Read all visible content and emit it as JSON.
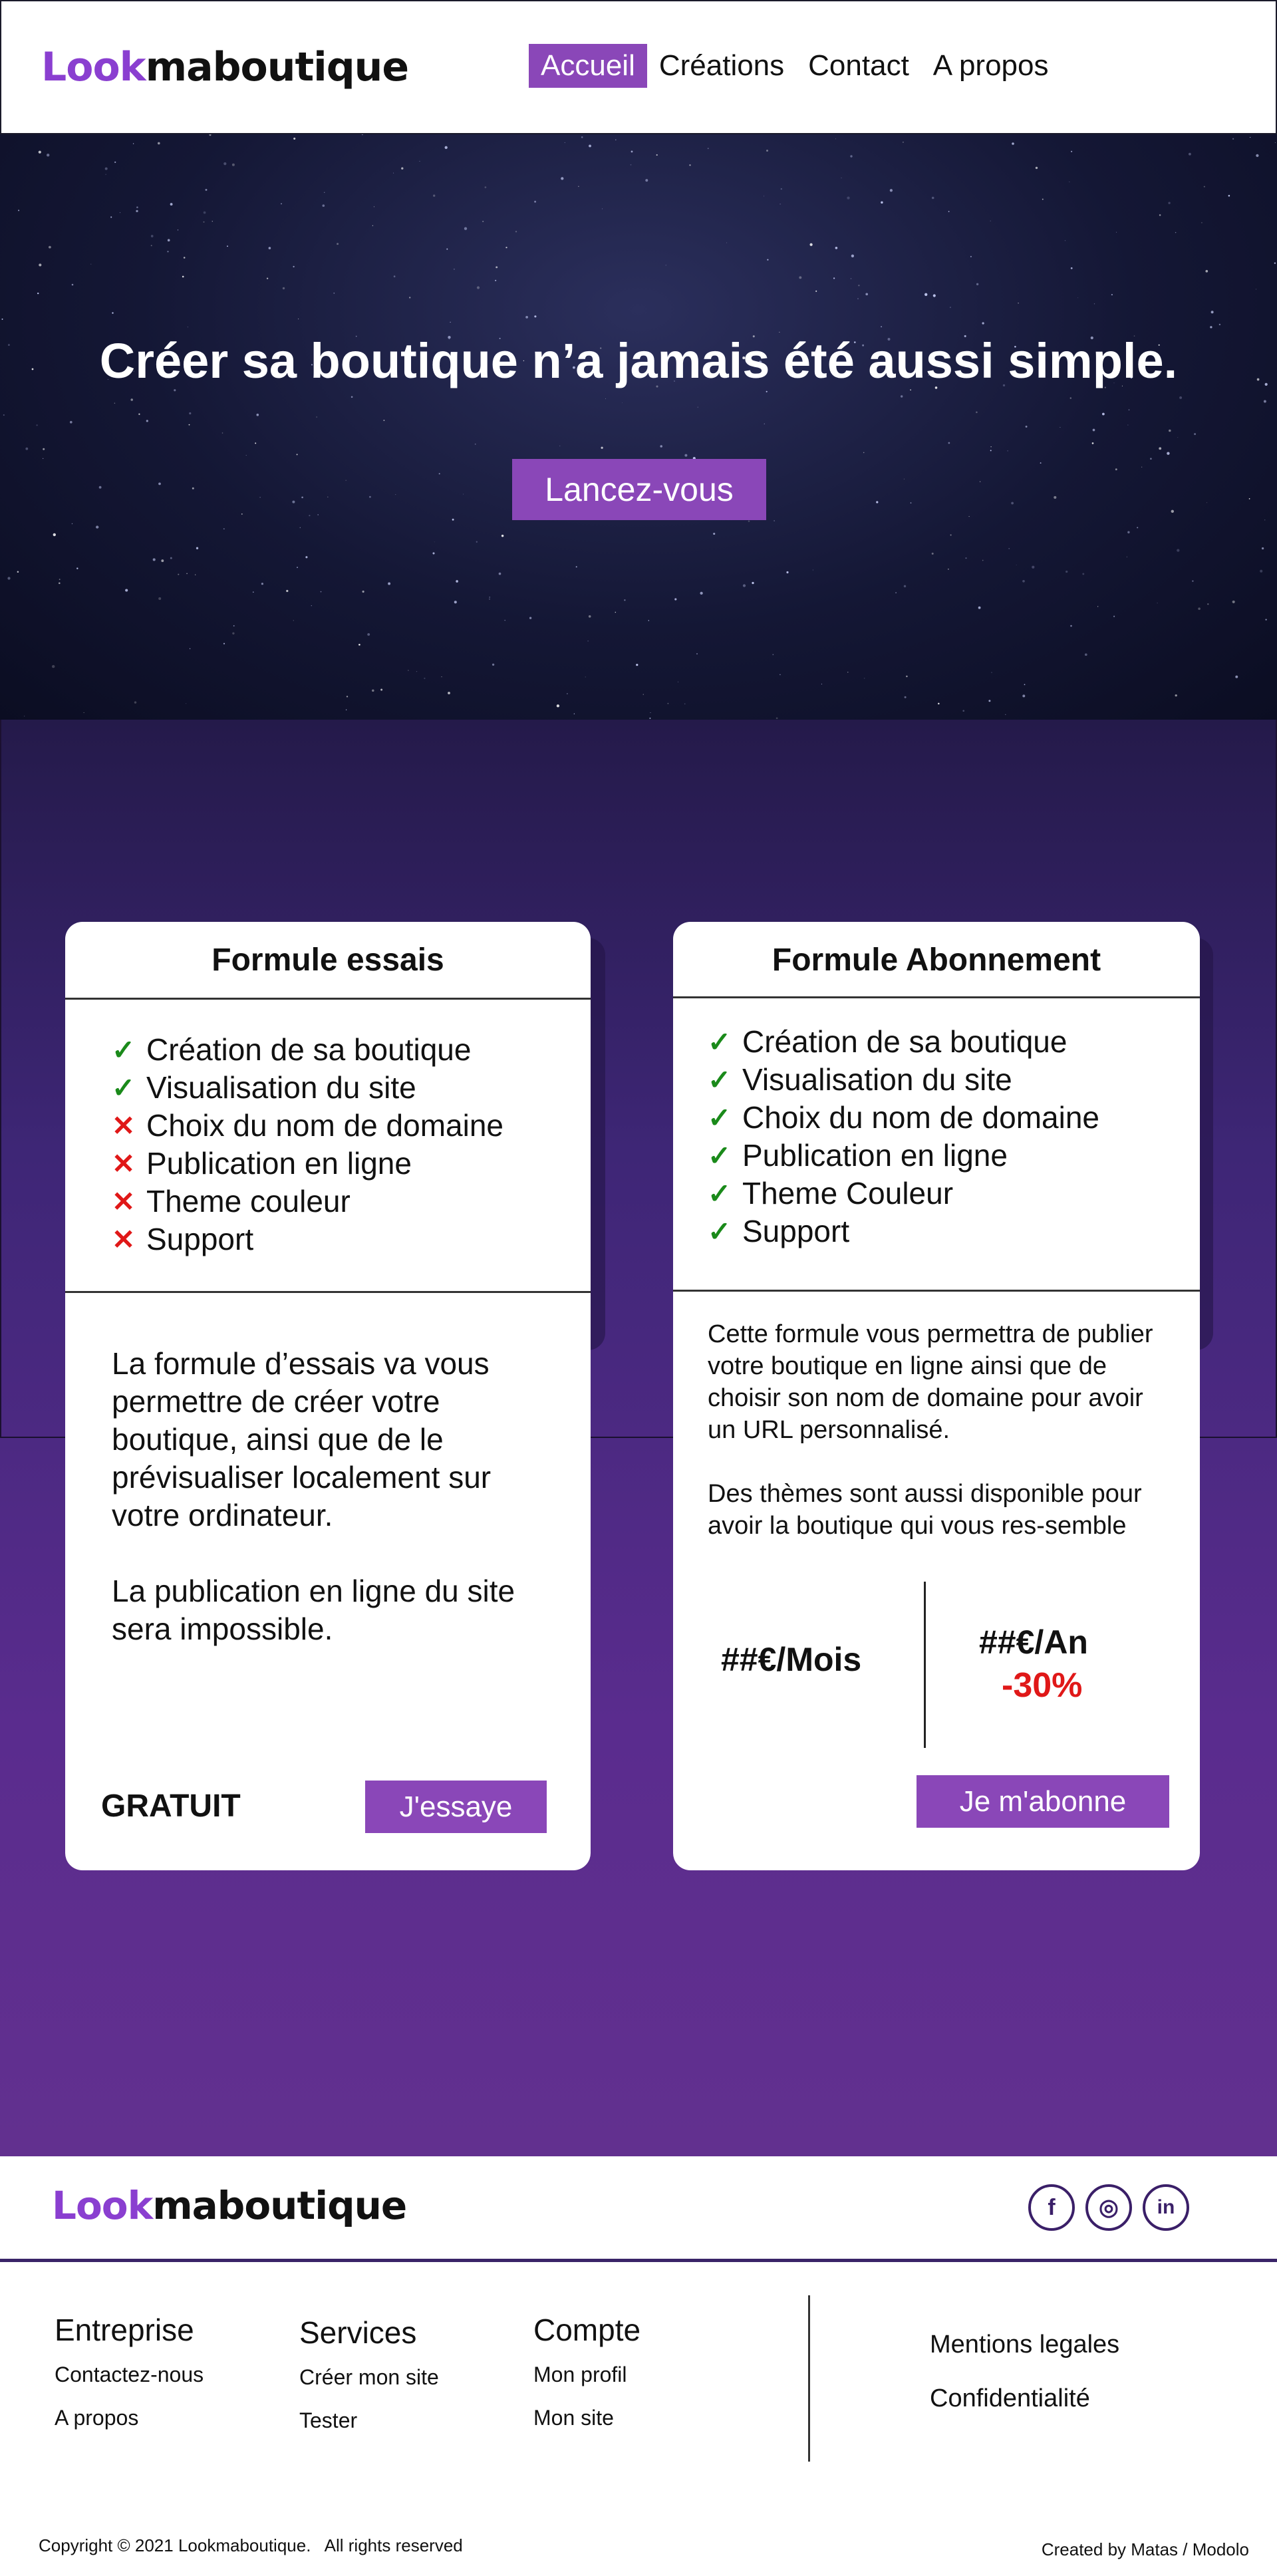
{
  "header": {
    "logo_part1": "Look",
    "logo_part2": "maboutique",
    "nav": [
      "Accueil",
      "Créations",
      "Contact",
      "A propos"
    ]
  },
  "hero": {
    "title": "Créer sa boutique n’a jamais été aussi simple.",
    "cta": "Lancez-vous"
  },
  "plans": {
    "trial": {
      "title": "Formule essais",
      "features": [
        {
          "label": "Création de sa boutique",
          "included": true
        },
        {
          "label": "Visualisation du site",
          "included": true
        },
        {
          "label": "Choix du nom de domaine",
          "included": false
        },
        {
          "label": "Publication en ligne",
          "included": false
        },
        {
          "label": "Theme couleur",
          "included": false
        },
        {
          "label": "Support",
          "included": false
        }
      ],
      "description_1": "La formule d’essais va vous permettre de créer votre boutique, ainsi que de le prévisualiser localement sur votre ordinateur.",
      "description_2": "La publication en ligne du site sera impossible.",
      "price": "GRATUIT",
      "button": "J'essaye"
    },
    "subscription": {
      "title": "Formule Abonnement",
      "features": [
        {
          "label": "Création de sa boutique",
          "included": true
        },
        {
          "label": "Visualisation du site",
          "included": true
        },
        {
          "label": "Choix du nom de domaine",
          "included": true
        },
        {
          "label": "Publication en ligne",
          "included": true
        },
        {
          "label": "Theme Couleur",
          "included": true
        },
        {
          "label": "Support",
          "included": true
        }
      ],
      "description_1": "Cette formule vous permettra de publier votre boutique en ligne ainsi que de choisir son nom de domaine pour avoir un URL personnalisé.",
      "description_2": "Des thèmes sont aussi disponible pour avoir la boutique qui vous res-semble",
      "price_month": "##€/Mois",
      "price_year": "##€/An",
      "discount": "-30%",
      "button": "Je m'abonne"
    },
    "check_glyph": "✓",
    "cross_glyph": "✕"
  },
  "footer": {
    "logo_part1": "Look",
    "logo_part2": "maboutique",
    "socials": [
      {
        "icon": "facebook-icon",
        "glyph": "f"
      },
      {
        "icon": "instagram-icon",
        "glyph": "◎"
      },
      {
        "icon": "linkedin-icon",
        "glyph": "in"
      }
    ],
    "columns": [
      {
        "title": "Entreprise",
        "links": [
          "Contactez-nous",
          "A propos"
        ]
      },
      {
        "title": "Services",
        "links": [
          "Créer mon site",
          "Tester"
        ]
      },
      {
        "title": "Compte",
        "links": [
          "Mon profil",
          "Mon site"
        ]
      }
    ],
    "legal": [
      "Mentions legales",
      "Confidentialité"
    ],
    "copyright": "Copyright © 2021 Lookmaboutique.   All rights reserved",
    "credit": "Created by Matas / Modolo"
  },
  "colors": {
    "brand": "#8a3fd0",
    "button": "#8a47b8",
    "check": "#1a8a1a",
    "cross": "#e01818",
    "discount": "#e01818"
  }
}
